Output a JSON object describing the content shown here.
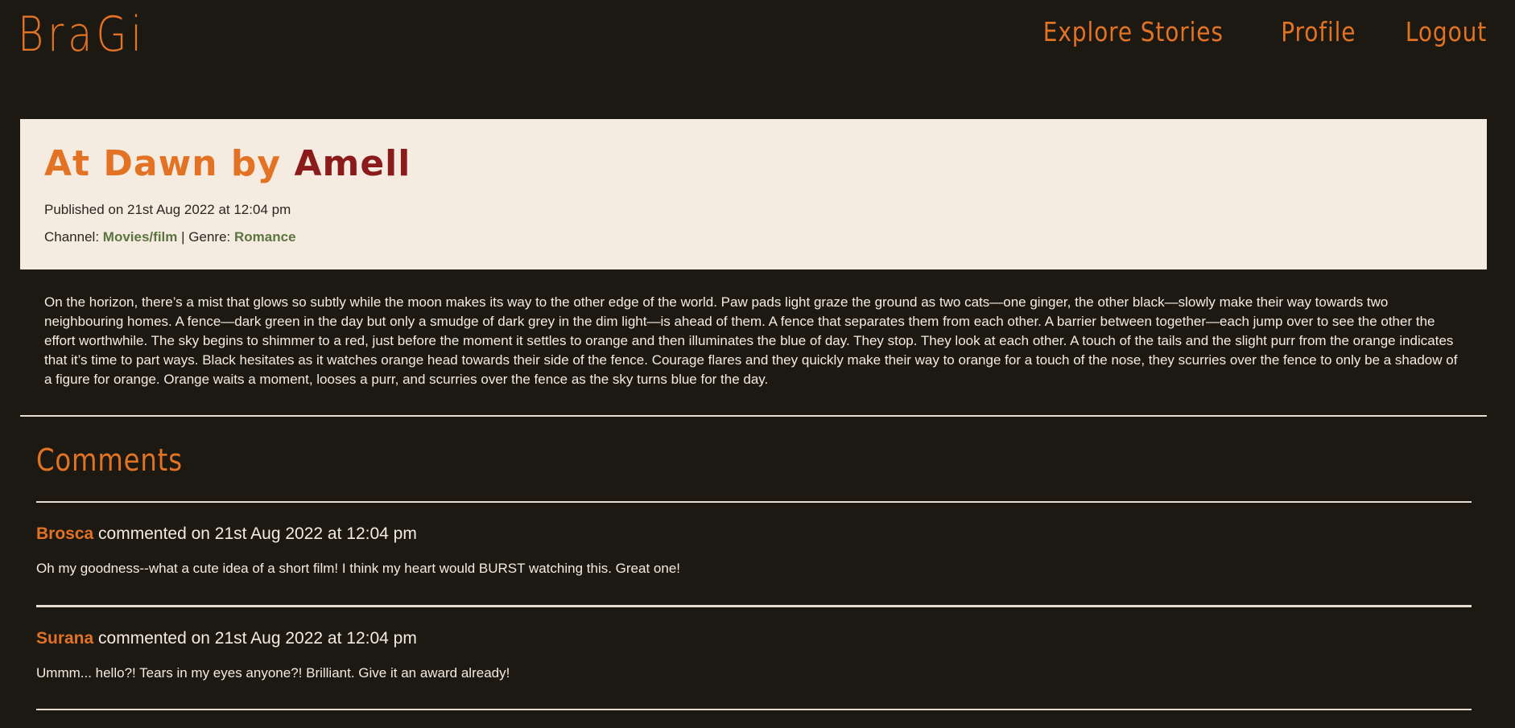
{
  "app": {
    "logo": "BraGi"
  },
  "nav": {
    "items": [
      {
        "label": "Explore Stories"
      },
      {
        "label": "Profile"
      },
      {
        "label": "Logout"
      }
    ]
  },
  "story": {
    "title": "At Dawn",
    "by": "by",
    "author": "Amell",
    "published_label": "Published on 21st Aug 2022 at 12:04 pm",
    "channel_label": "Channel:",
    "channel": "Movies/film",
    "separator": "|",
    "genre_label": "Genre:",
    "genre": "Romance",
    "body": "On the horizon, there’s a mist that glows so subtly while the moon makes its way to the other edge of the world. Paw pads light graze the ground as two cats—one ginger, the other black—slowly make their way towards two neighbouring homes. A fence—dark green in the day but only a smudge of dark grey in the dim light—is ahead of them. A fence that separates them from each other. A barrier between together—each jump over to see the other the effort worthwhile. The sky begins to shimmer to a red, just before the moment it settles to orange and then illuminates the blue of day. They stop. They look at each other. A touch of the tails and the slight purr from the orange indicates that it’s time to part ways. Black hesitates as it watches orange head towards their side of the fence. Courage flares and they quickly make their way to orange for a touch of the nose, they scurries over the fence to only be a shadow of a figure for orange. Orange waits a moment, looses a purr, and scurries over the fence as the sky turns blue for the day."
  },
  "comments": {
    "title": "Comments",
    "items": [
      {
        "user": "Brosca",
        "meta": "commented on 21st Aug 2022 at 12:04 pm",
        "text": "Oh my goodness--what a cute idea of a short film! I think my heart would BURST watching this. Great one!"
      },
      {
        "user": "Surana",
        "meta": "commented on 21st Aug 2022 at 12:04 pm",
        "text": "Ummm... hello?! Tears in my eyes anyone?! Brilliant. Give it an award already!"
      }
    ]
  },
  "colors": {
    "background": "#1c1812",
    "accent": "#e27224",
    "author": "#8b1a1a",
    "link": "#5b7440",
    "panel": "#f6ebe1"
  }
}
